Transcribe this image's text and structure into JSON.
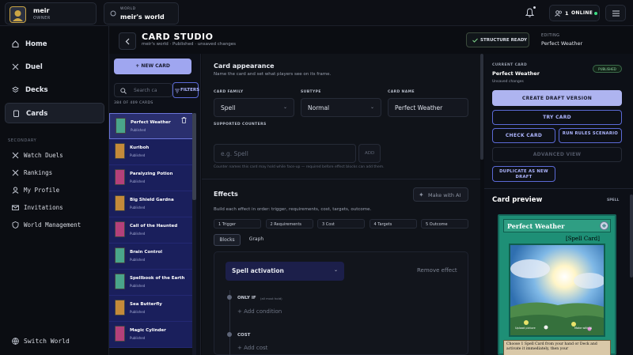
{
  "user": {
    "name": "meir",
    "role": "OWNER"
  },
  "world": {
    "label": "WORLD",
    "name": "meir's world"
  },
  "topbar": {
    "online_count": "1",
    "online_label": "ONLINE"
  },
  "nav": {
    "main": [
      {
        "label": "Home",
        "icon": "home-icon"
      },
      {
        "label": "Duel",
        "icon": "swords-icon"
      },
      {
        "label": "Decks",
        "icon": "layers-icon"
      },
      {
        "label": "Cards",
        "icon": "cards-icon",
        "active": true
      }
    ],
    "secondary_label": "SECONDARY",
    "secondary": [
      {
        "label": "Watch Duels",
        "icon": "swords-icon"
      },
      {
        "label": "Rankings",
        "icon": "swords-icon"
      },
      {
        "label": "My Profile",
        "icon": "user-icon"
      },
      {
        "label": "Invitations",
        "icon": "mail-icon"
      },
      {
        "label": "World Management",
        "icon": "shield-icon"
      }
    ],
    "switch_world": "Switch World"
  },
  "header": {
    "title": "CARD STUDIO",
    "subtitle": "meir's world · Published · unsaved changes",
    "structure_ready": "STRUCTURE READY",
    "editing_label": "EDITING",
    "editing_value": "Perfect Weather"
  },
  "cardlist": {
    "new_card": "+ NEW CARD",
    "search_placeholder": "Search ca",
    "filters": "FILTERS",
    "count": "384 OF 409 CARDS",
    "items": [
      {
        "name": "Perfect Weather",
        "status": "Published",
        "color": "#4aa58a"
      },
      {
        "name": "Kuriboh",
        "status": "Published",
        "color": "#c48a3a"
      },
      {
        "name": "Paralyzing Potion",
        "status": "Published",
        "color": "#b4407a"
      },
      {
        "name": "Big Shield Gardna",
        "status": "Published",
        "color": "#c48a3a"
      },
      {
        "name": "Call of the Haunted",
        "status": "Published",
        "color": "#b4407a"
      },
      {
        "name": "Brain Control",
        "status": "Published",
        "color": "#4aa58a"
      },
      {
        "name": "Spellbook of the Earth",
        "status": "Published",
        "color": "#4aa58a"
      },
      {
        "name": "Sea Butterfly",
        "status": "Published",
        "color": "#c48a3a"
      },
      {
        "name": "Magic Cylinder",
        "status": "Published",
        "color": "#b4407a"
      }
    ]
  },
  "appearance": {
    "title": "Card appearance",
    "desc": "Name the card and set what players see on its frame.",
    "family_label": "CARD FAMILY",
    "family_value": "Spell",
    "subtype_label": "SUBTYPE",
    "subtype_value": "Normal",
    "name_label": "CARD NAME",
    "name_value": "Perfect Weather",
    "counters_label": "SUPPORTED COUNTERS",
    "counters_placeholder": "e.g. Spell",
    "add": "ADD",
    "counters_hint": "Counter names this card may hold while face-up — required before effect blocks can add them."
  },
  "effects": {
    "title": "Effects",
    "make_ai": "Make with AI",
    "desc": "Build each effect in order: trigger, requirements, cost, targets, outcome.",
    "steps": [
      "1  Trigger",
      "2  Requirements",
      "3  Cost",
      "4  Targets",
      "5  Outcome"
    ],
    "tabs": [
      "Blocks",
      "Graph"
    ],
    "activation": "Spell activation",
    "remove": "Remove effect",
    "only_if": "ONLY IF",
    "only_if_hint": "(all must hold)",
    "add_condition": "+ Add condition",
    "cost": "COST",
    "add_cost": "+ Add cost"
  },
  "current": {
    "label": "CURRENT CARD",
    "name": "Perfect Weather",
    "badge": "PUBLISHED",
    "status": "Unsaved changes",
    "create_draft": "CREATE DRAFT VERSION",
    "try_card": "TRY CARD",
    "check_card": "CHECK CARD",
    "run_rules": "RUN RULES SCENARIO",
    "advanced": "ADVANCED VIEW",
    "duplicate": "DUPLICATE AS NEW DRAFT"
  },
  "preview": {
    "title": "Card preview",
    "tag": "SPELL",
    "card_name": "Perfect Weather",
    "card_type": "[Spell Card]",
    "art_left": "Upload picture",
    "art_right": "Make with AI",
    "text": "Choose 1 Spell Card from your hand or Deck and activate it immediately, then your"
  }
}
